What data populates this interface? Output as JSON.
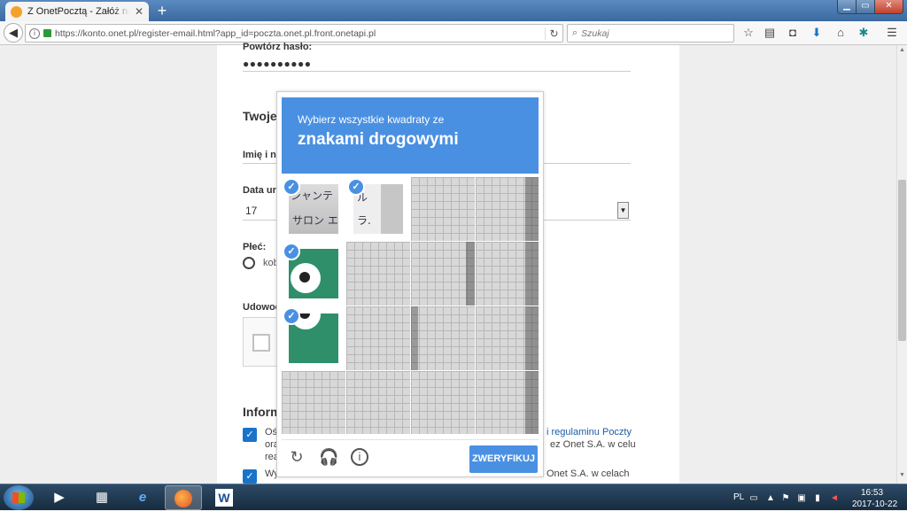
{
  "browser": {
    "tab_title": "Z OnetPocztą - Załóż nowe konto",
    "tab_close": "✕",
    "new_tab": "+",
    "url": "https://konto.onet.pl/register-email.html?app_id=poczta.onet.pl.front.onetapi.pl",
    "search_placeholder": "Szukaj"
  },
  "form": {
    "repeat_password_label": "Powtórz hasło:",
    "password_dots": "●●●●●●●●●●",
    "section_title": "Twoje",
    "name_label": "Imię i na",
    "birthdate_label": "Data uro",
    "day_value": "17",
    "gender_label": "Płeć:",
    "gender_option": "kob",
    "verify_label": "Udowod",
    "info_title": "Inform",
    "consent1_line1_a": "Oś",
    "consent1_link": "i regulaminu Poczty",
    "consent1_line2_a": "ora",
    "consent1_line2_b": "ez Onet S.A. w celu",
    "consent1_line3_a": "rea",
    "consent2_line1_a": "Wy",
    "consent2_line1_b": "Onet S.A. w celach"
  },
  "captcha": {
    "instruction": "Wybierz wszystkie kwadraty ze",
    "target": "znakami drogowymi",
    "verify_button": "ZWERYFIKUJ",
    "selected_tiles": [
      "r1c1",
      "r1c2",
      "r2c1",
      "r3c1"
    ],
    "check_mark": "✓"
  },
  "taskbar": {
    "language": "PL",
    "time": "16:53",
    "date": "2017-10-22",
    "apps": [
      "windows-media-player",
      "file-explorer",
      "internet-explorer",
      "firefox",
      "word"
    ]
  }
}
